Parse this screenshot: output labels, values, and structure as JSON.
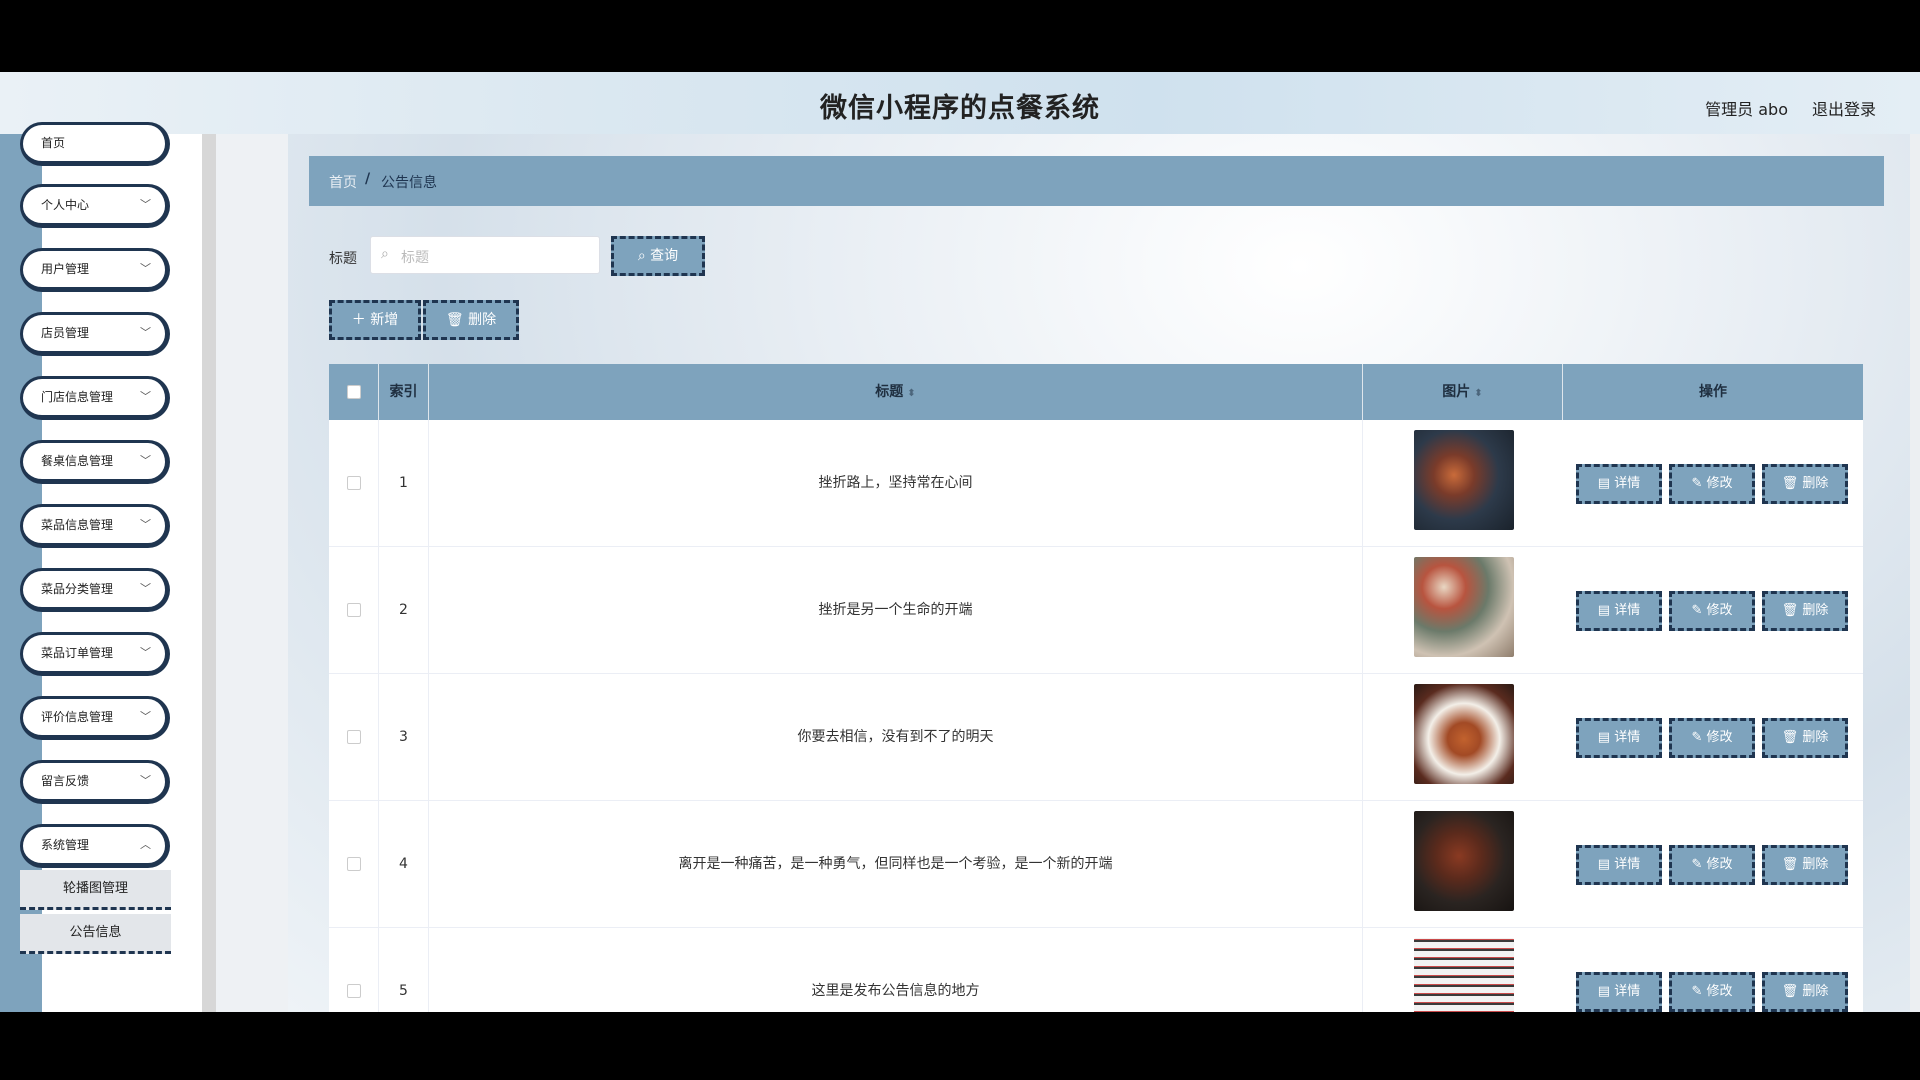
{
  "header": {
    "title": "微信小程序的点餐系统",
    "user": "管理员 abo",
    "logout": "退出登录"
  },
  "sidebar": {
    "items": [
      {
        "label": "首页"
      },
      {
        "label": "个人中心"
      },
      {
        "label": "用户管理"
      },
      {
        "label": "店员管理"
      },
      {
        "label": "门店信息管理"
      },
      {
        "label": "餐桌信息管理"
      },
      {
        "label": "菜品信息管理"
      },
      {
        "label": "菜品分类管理"
      },
      {
        "label": "菜品订单管理"
      },
      {
        "label": "评价信息管理"
      },
      {
        "label": "留言反馈"
      },
      {
        "label": "系统管理"
      }
    ],
    "sub_items": [
      {
        "label": "轮播图管理"
      },
      {
        "label": "公告信息"
      }
    ]
  },
  "breadcrumb": {
    "home": "首页",
    "sep": "/",
    "current": "公告信息"
  },
  "search": {
    "label": "标题",
    "placeholder": "标题",
    "button": "查询"
  },
  "toolbar": {
    "add": "新增",
    "delete": "删除"
  },
  "table": {
    "headers": {
      "index": "索引",
      "title": "标题",
      "image": "图片",
      "actions": "操作"
    },
    "rows": [
      {
        "index": "1",
        "title": "挫折路上，坚持常在心间"
      },
      {
        "index": "2",
        "title": "挫折是另一个生命的开端"
      },
      {
        "index": "3",
        "title": "你要去相信，没有到不了的明天"
      },
      {
        "index": "4",
        "title": "离开是一种痛苦，是一种勇气，但同样也是一个考验，是一个新的开端"
      },
      {
        "index": "5",
        "title": "这里是发布公告信息的地方"
      }
    ],
    "actions": {
      "detail": "详情",
      "edit": "修改",
      "delete": "删除"
    }
  },
  "colors": {
    "accent": "#7ea3bd",
    "border_dark": "#1f3550"
  }
}
